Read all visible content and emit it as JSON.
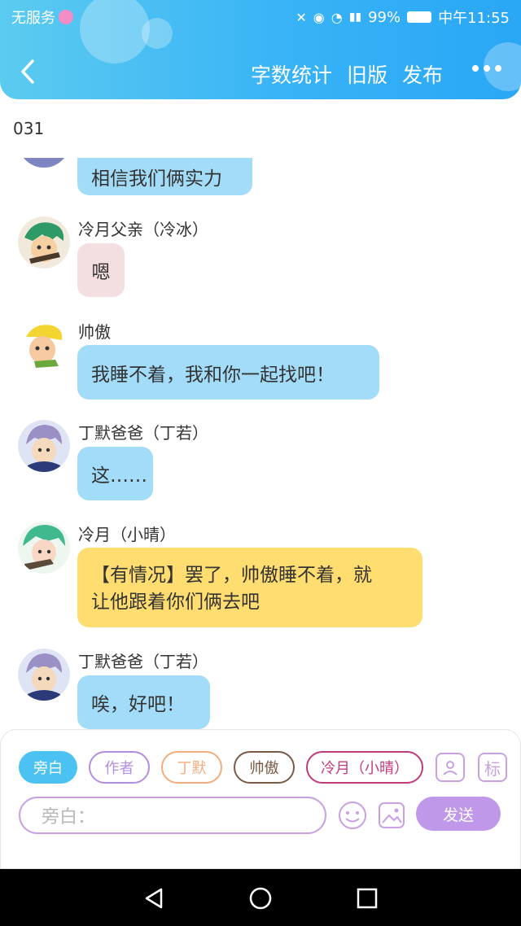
{
  "status_bar": {
    "carrier": "无服务",
    "battery": "99%",
    "time": "中午11:55"
  },
  "header": {
    "word_count": "字数统计",
    "old_version": "旧版",
    "publish": "发布"
  },
  "page_number": "031",
  "messages": [
    {
      "name": "",
      "text": "相信我们俩实力",
      "style": "blue"
    },
    {
      "name": "冷月父亲（冷冰）",
      "text": "嗯",
      "style": "pink"
    },
    {
      "name": "帅傲",
      "text": "我睡不着，我和你一起找吧！",
      "style": "blue"
    },
    {
      "name": "丁默爸爸（丁若）",
      "text": "这……",
      "style": "blue"
    },
    {
      "name": "冷月（小晴）",
      "line1": "【有情况】罢了，帅傲睡不着，就",
      "line2": "让他跟着你们俩去吧",
      "style": "yellow"
    },
    {
      "name": "丁默爸爸（丁若）",
      "text": "唉，好吧！",
      "style": "blue"
    }
  ],
  "roles": [
    "旁白",
    "作者",
    "丁默",
    "帅傲",
    "冷月（小晴）"
  ],
  "marker_label": "标",
  "input": {
    "placeholder": "旁白："
  },
  "send_label": "发送",
  "colors": {
    "header_blue": "#38b3f6",
    "bubble_blue": "#a3dcf8",
    "bubble_yellow": "#ffdd70",
    "bubble_pink": "#f3dfe0",
    "accent_purple": "#c098ea"
  }
}
